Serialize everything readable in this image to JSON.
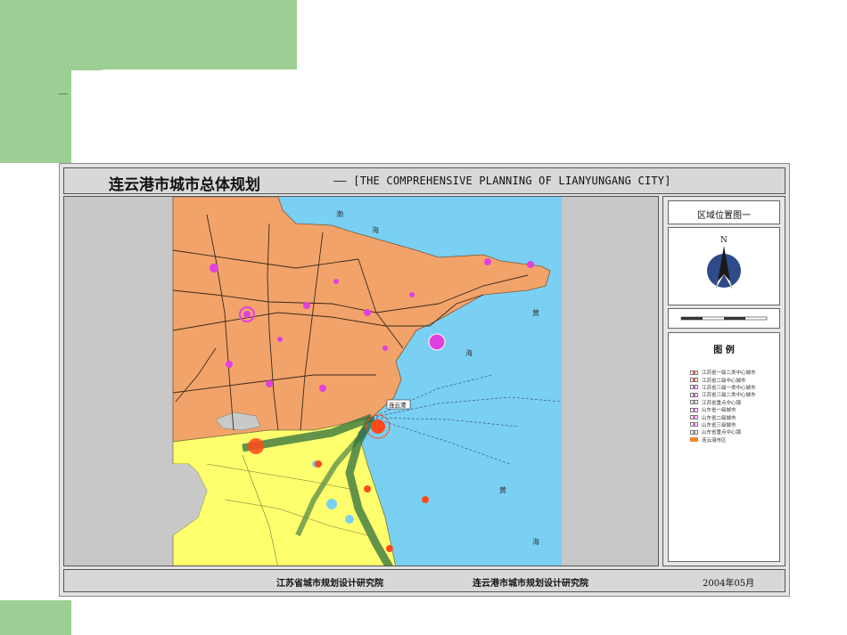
{
  "slide": {
    "title_cn": "连云港市城市总体规划",
    "title_en": "—— [THE COMPREHENSIVE PLANNING OF LIANYUNGANG CITY]"
  },
  "map": {
    "labels": {
      "sea_bo": "渤",
      "sea_hai1": "海",
      "sea_huang1": "黄",
      "sea_hai2": "海",
      "sea_huang2": "黄",
      "sea_hai3": "海",
      "city_lyg": "连云港"
    },
    "colors": {
      "sea": "#7ad0f2",
      "shandong": "#f2a36a",
      "jiangsu": "#ffff6e",
      "outside": "#c8c8c8",
      "city_marker": "#e040e0",
      "lyg_marker": "#ff4a1a"
    }
  },
  "panel": {
    "position_title": "区域位置图一",
    "north_label": "N",
    "legend_title": "图 例",
    "legend_items": [
      {
        "label": "江苏省一级二类中心城市",
        "color": "#e23b2a"
      },
      {
        "label": "江苏省二级中心城市",
        "color": "#e23b2a"
      },
      {
        "label": "江苏省三级一类中心城市",
        "color": "#b040c0"
      },
      {
        "label": "江苏省三级二类中心城市",
        "color": "#b040c0"
      },
      {
        "label": "江苏省重点中心镇",
        "color": "#888888"
      },
      {
        "label": "山东省一级城市",
        "color": "#e040e0"
      },
      {
        "label": "山东省二级城市",
        "color": "#e040e0"
      },
      {
        "label": "山东省三级城市",
        "color": "#e040e0"
      },
      {
        "label": "山东省重点中心镇",
        "color": "#888888"
      },
      {
        "label": "连云港市区",
        "color": "#f08a2a"
      }
    ]
  },
  "footer": {
    "org1": "江苏省城市规划设计研究院",
    "org2": "连云港市城市规划设计研究院",
    "date": "2004年05月"
  }
}
